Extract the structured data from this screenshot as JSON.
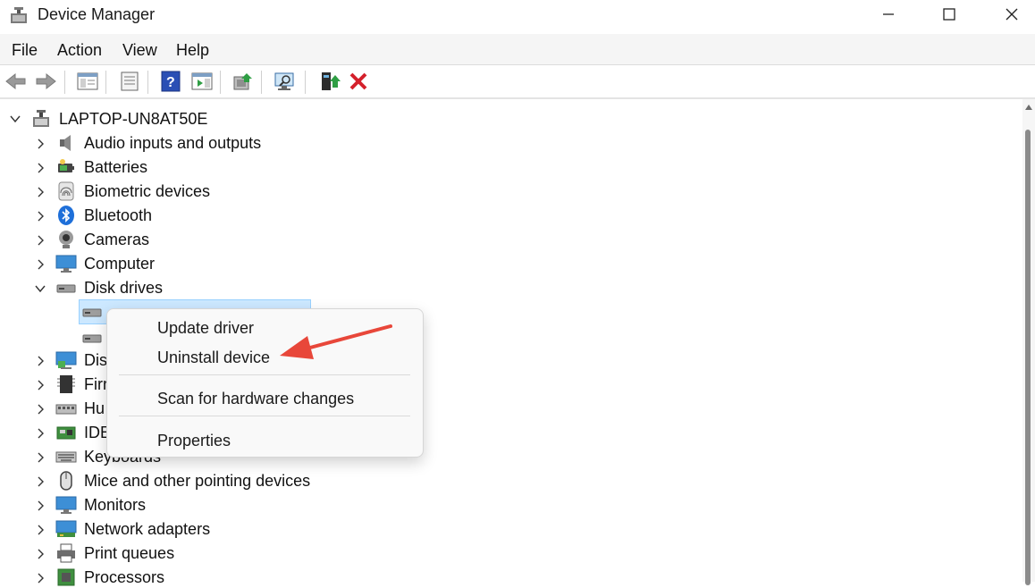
{
  "window": {
    "title": "Device Manager"
  },
  "menubar": {
    "items": [
      "File",
      "Action",
      "View",
      "Help"
    ]
  },
  "tree": {
    "root": "LAPTOP-UN8AT50E",
    "categories": [
      "Audio inputs and outputs",
      "Batteries",
      "Biometric devices",
      "Bluetooth",
      "Cameras",
      "Computer",
      "Disk drives",
      "Dis",
      "Firr",
      "Hu",
      "IDE",
      "Keyboards",
      "Mice and other pointing devices",
      "Monitors",
      "Network adapters",
      "Print queues",
      "Processors"
    ]
  },
  "context_menu": {
    "items": [
      "Update driver",
      "Uninstall device",
      "Scan for hardware changes",
      "Properties"
    ]
  },
  "colors": {
    "annotation_arrow": "#e8473a",
    "selection": "#cce8ff"
  }
}
